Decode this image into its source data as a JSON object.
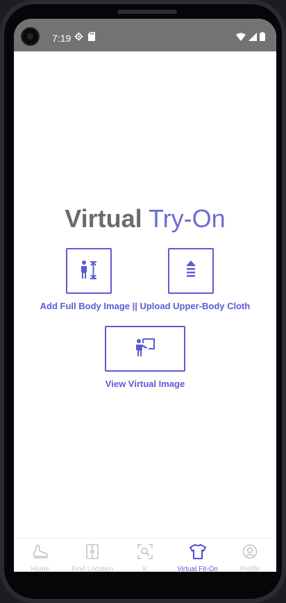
{
  "status_bar": {
    "time": "7:19",
    "icons_left": [
      "settings-gear-icon",
      "sd-card-icon"
    ],
    "icons_right": [
      "wifi-icon",
      "cell-signal-icon",
      "battery-icon"
    ]
  },
  "page": {
    "title_bold": "Virtual",
    "title_light": "Try-On",
    "buttons": {
      "full_body": {
        "icon": "person-height-icon"
      },
      "upload_cloth": {
        "icon": "upload-arrow-icon"
      },
      "view_virtual": {
        "icon": "presentation-person-icon"
      }
    },
    "row1_label": "Add Full Body Image || Upload Upper-Body Cloth",
    "row2_label": "View Virtual Image"
  },
  "bottom_nav": {
    "items": [
      {
        "label": "Home",
        "icon": "shoe-home-icon",
        "active": false
      },
      {
        "label": "Find Location",
        "icon": "wardrobe-icon",
        "active": false
      },
      {
        "label": "K",
        "icon": "scan-search-icon",
        "active": false
      },
      {
        "label": "Virtual Fit-On",
        "icon": "tshirt-icon",
        "active": true
      },
      {
        "label": "Profile",
        "icon": "profile-icon",
        "active": false
      }
    ]
  },
  "colors": {
    "accent": "#5b5bd6",
    "status_bar_bg": "#737373",
    "title_gray": "#6b6b6b",
    "nav_inactive": "#c4c4c4"
  }
}
